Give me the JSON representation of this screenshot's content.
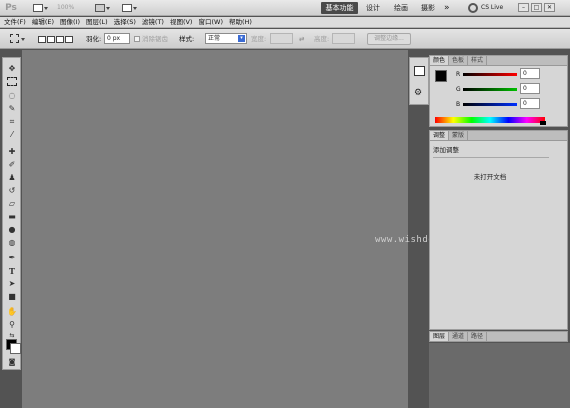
{
  "app": {
    "logo": "Ps",
    "zoom": "100%"
  },
  "workspace": {
    "basic": "基本功能",
    "design": "设计",
    "paint": "绘画",
    "photo": "摄影",
    "more": "»",
    "cslive": "CS Live"
  },
  "window_buttons": [
    "–",
    "□",
    "✕"
  ],
  "menu": [
    "文件(F)",
    "编辑(E)",
    "图像(I)",
    "图层(L)",
    "选择(S)",
    "滤镜(T)",
    "视图(V)",
    "窗口(W)",
    "帮助(H)"
  ],
  "options": {
    "feather_label": "羽化:",
    "feather_value": "0 px",
    "antialias_label": "消除锯齿",
    "style_label": "样式:",
    "style_value": "正常",
    "width_label": "宽度:",
    "height_label": "高度:",
    "refine_edge": "调整边缘..."
  },
  "color_panel": {
    "tabs": [
      "颜色",
      "色板",
      "样式"
    ],
    "channels": [
      {
        "label": "R",
        "value": "0",
        "color": "#d01010"
      },
      {
        "label": "G",
        "value": "0",
        "color": "#12a012"
      },
      {
        "label": "B",
        "value": "0",
        "color": "#1030c0"
      }
    ]
  },
  "adjust_panel": {
    "tabs": [
      "调整",
      "蒙版"
    ],
    "heading": "添加调整",
    "message": "未打开文档"
  },
  "bottom_panel": {
    "tabs": [
      "图层",
      "通道",
      "路径"
    ]
  },
  "watermark": "www.wishdown.com",
  "colors": {
    "canvas": "#7d7d7d",
    "panel": "#d6d6d6",
    "accent": "#4a4a4a"
  }
}
